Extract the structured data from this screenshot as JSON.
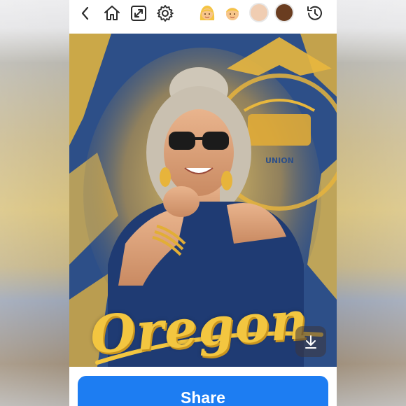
{
  "toolbar": {
    "back_icon": "chevron-left-icon",
    "home_icon": "home-icon",
    "resize_icon": "resize-icon",
    "settings_icon": "gear-icon",
    "history_icon": "history-icon",
    "avatar_options": [
      "woman-emoji",
      "man-emoji"
    ],
    "skin_tones": [
      "#f0cdb2",
      "#6a3d20"
    ]
  },
  "artwork": {
    "caption": "Oregon",
    "seal_text": "UNION",
    "colors": {
      "blue": "#2c4e86",
      "gold": "#f3c640"
    }
  },
  "actions": {
    "download_icon": "download-icon",
    "share_label": "Share"
  }
}
